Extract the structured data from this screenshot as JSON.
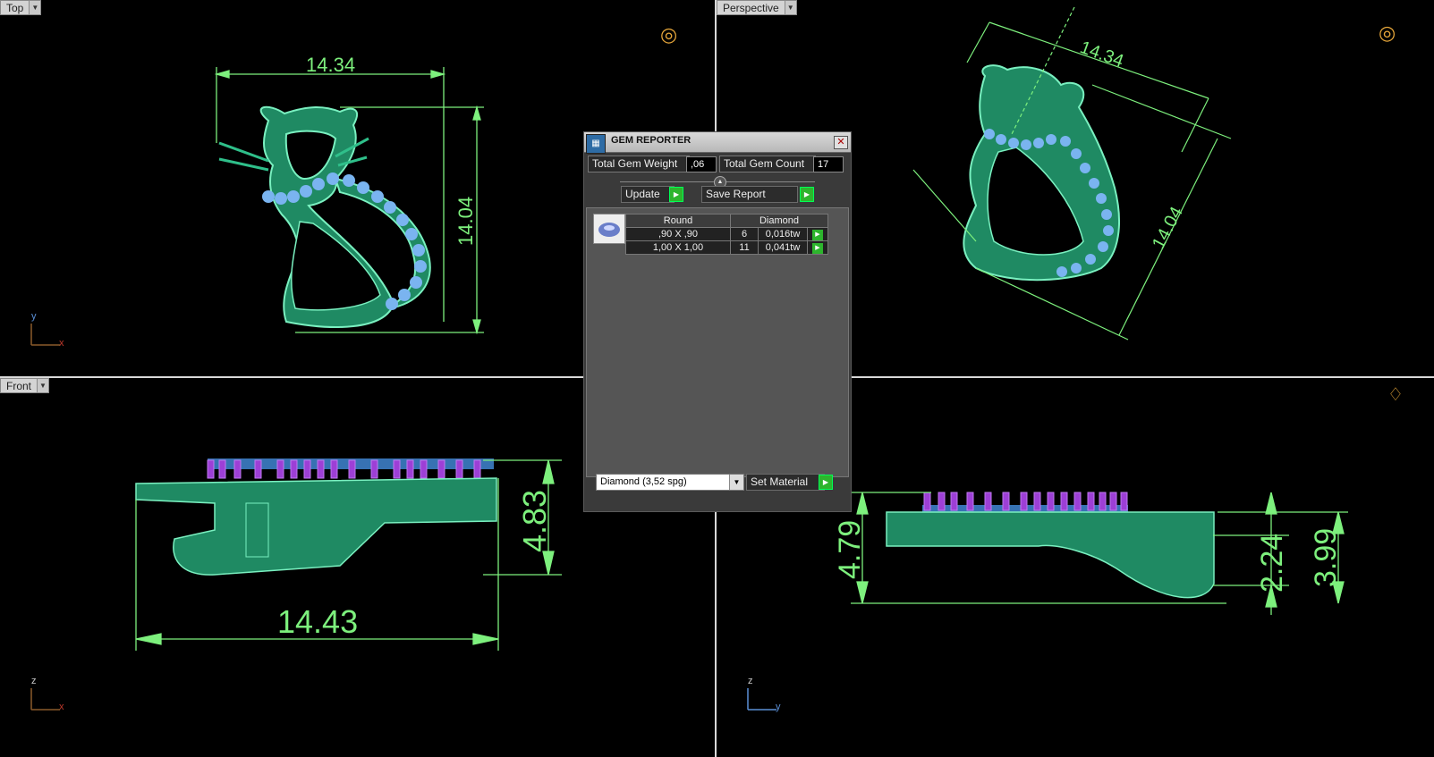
{
  "viewports": {
    "top": {
      "label": "Top",
      "axes": {
        "v": "y",
        "h": "x"
      }
    },
    "perspective": {
      "label": "Perspective"
    },
    "front": {
      "label": "Front",
      "axes": {
        "v": "z",
        "h": "x"
      }
    },
    "right": {
      "label": "",
      "axes": {
        "v": "z",
        "h": "y"
      }
    }
  },
  "dimensions": {
    "top_width": "14.34",
    "top_height": "14.04",
    "persp_width": "14.34",
    "persp_height": "14.04",
    "front_width": "14.43",
    "front_height": "4.83",
    "right_height_left": "4.79",
    "right_height_mid": "2.24",
    "right_height_right": "3.99"
  },
  "gem_reporter": {
    "title": "GEM REPORTER",
    "title_icon": "gem-reporter-icon",
    "total_weight_label": "Total Gem Weight",
    "total_weight_value": ",06",
    "total_count_label": "Total Gem Count",
    "total_count_value": "17",
    "update_label": "Update",
    "save_report_label": "Save Report",
    "table": {
      "headers": [
        "Round",
        "Diamond"
      ],
      "rows": [
        {
          "size": ",90 X ,90",
          "count": "6",
          "weight": "0,016tw"
        },
        {
          "size": "1,00 X 1,00",
          "count": "11",
          "weight": "0,041tw"
        }
      ]
    },
    "material_select": "Diamond      (3,52 spg)",
    "set_material_label": "Set Material"
  },
  "colors": {
    "model": "#2f9e77",
    "model_line": "#7af0c0",
    "gem": "#7ab4f0",
    "prong": "#9d3fd6",
    "dimension": "#7df07d",
    "axis_x": "#c0392b",
    "axis_y": "#5a8fd6",
    "axis_z": "#c9c9c9"
  }
}
